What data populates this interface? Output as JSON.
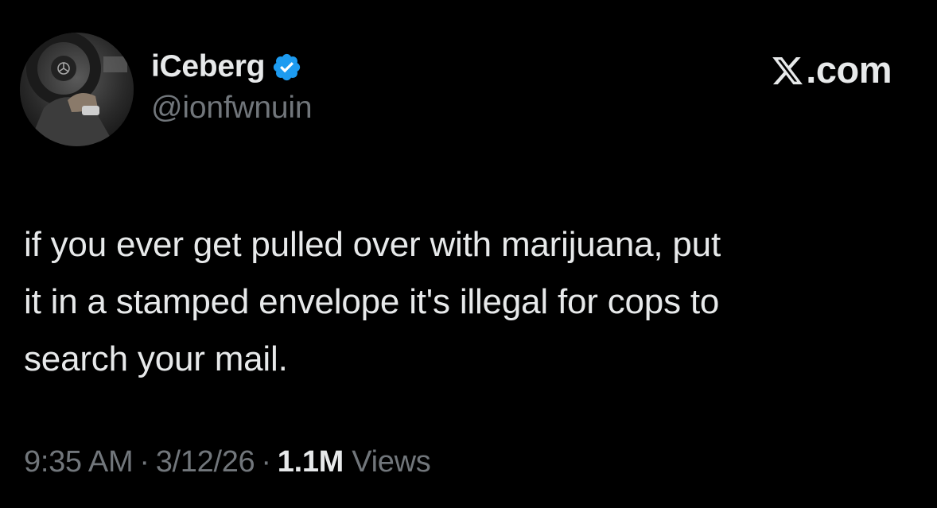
{
  "author": {
    "display_name": "iCeberg",
    "handle": "@ionfwnuin",
    "verified": true,
    "avatar_icon": "avatar-photo-steering-wheel"
  },
  "brand": {
    "label": "X.com",
    "icon": "x-logo-icon"
  },
  "tweet": {
    "text_lines": [
      "if you ever get pulled over with marijuana, put",
      "it in a stamped envelope it's illegal for cops to",
      "search your mail."
    ]
  },
  "meta": {
    "time": "9:35 AM",
    "separator": "·",
    "date": "3/12/26",
    "views_count": "1.1M",
    "views_label": "Views"
  },
  "colors": {
    "background": "#000000",
    "primary_text": "#e7e9ea",
    "secondary_text": "#71767b",
    "verified_badge": "#1d9bf0"
  }
}
